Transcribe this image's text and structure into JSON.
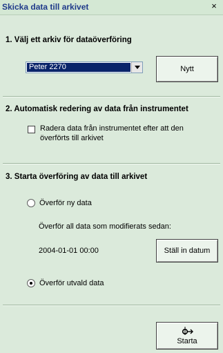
{
  "window": {
    "title": "Skicka data till arkivet",
    "close_glyph": "×"
  },
  "section1": {
    "title": "1.  Välj ett arkiv för dataöverföring",
    "archive_select": {
      "selected": "Peter 2270"
    },
    "new_button": "Nytt"
  },
  "section2": {
    "title": "2.  Automatisk redering av data från instrumentet",
    "delete_checkbox": {
      "checked": false,
      "label_line1": "Radera data från instrumentet efter att den",
      "label_line2": "överförts till arkivet"
    }
  },
  "section3": {
    "title": "3.  Starta överföring av data till arkivet",
    "radio_new": {
      "label": "Överför ny data",
      "selected": false
    },
    "modified_since_label": "Överför all data som modifierats sedan:",
    "date_value": "2004-01-01 00:00",
    "set_date_button": "Ställ in datum",
    "radio_selected": {
      "label": "Överför utvald data",
      "selected": true
    }
  },
  "start_button": {
    "icon": "transfer-icon",
    "label": "Starta"
  }
}
